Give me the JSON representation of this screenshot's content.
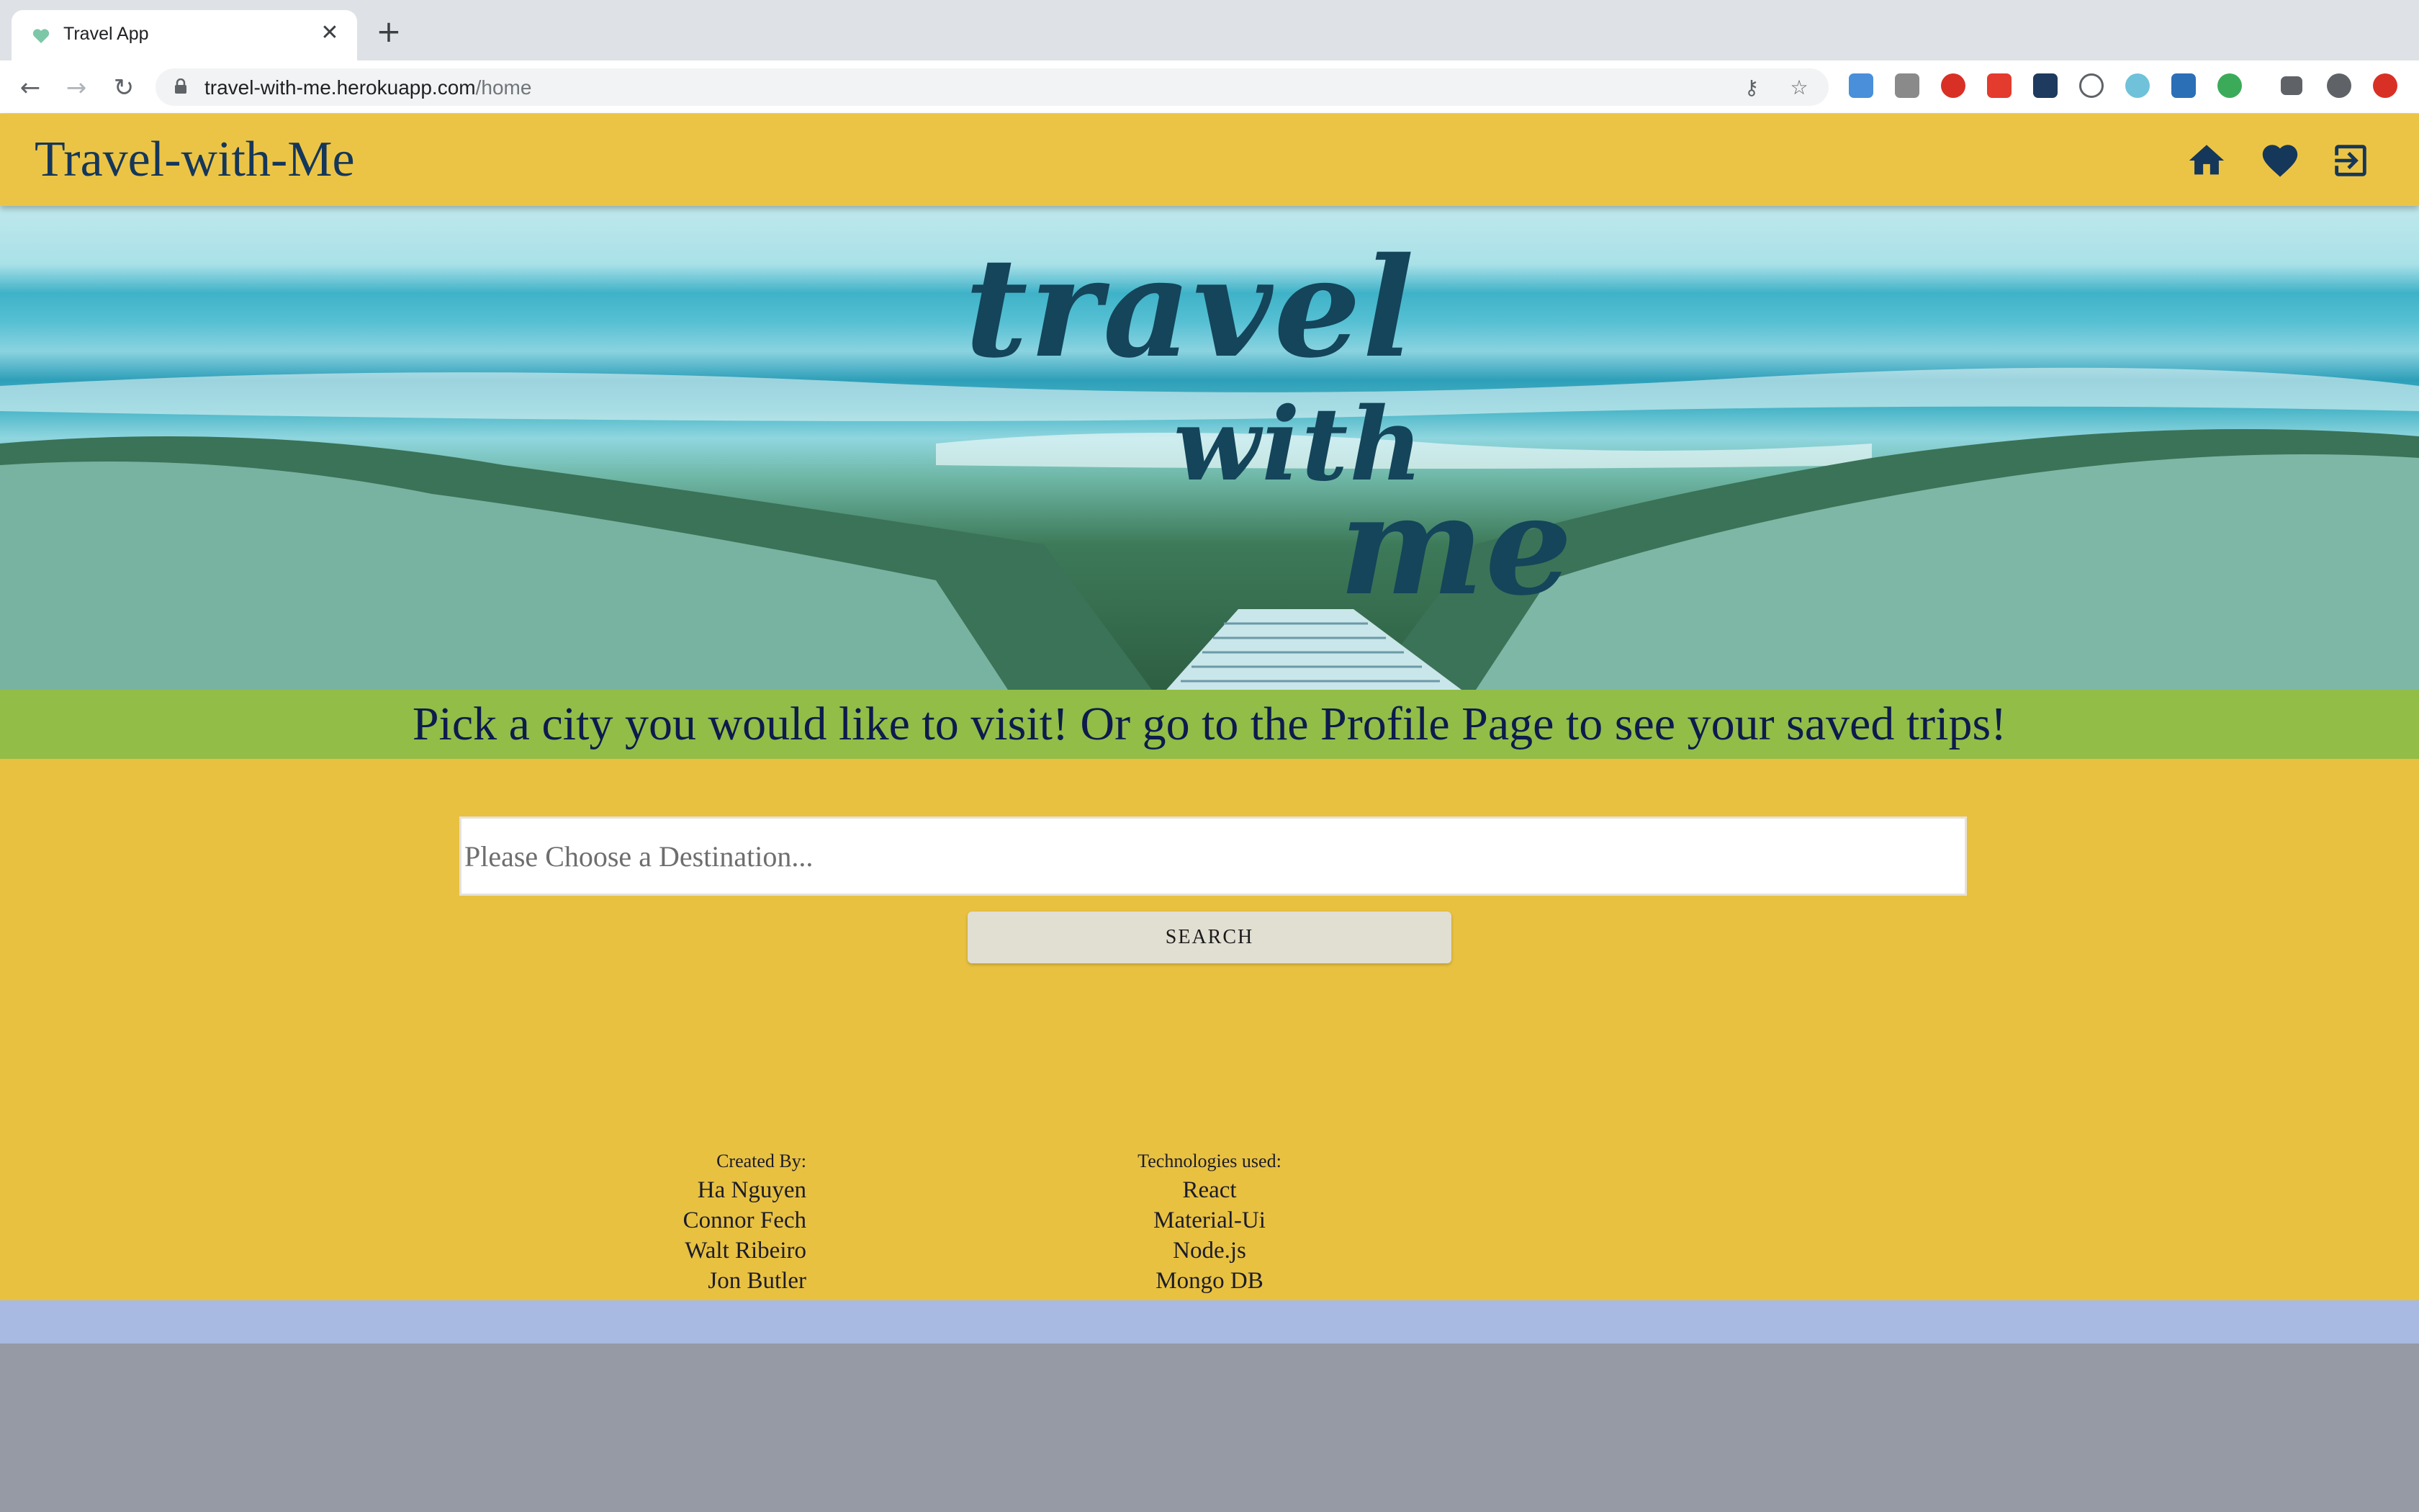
{
  "browser": {
    "tab_title": "Travel App",
    "close_glyph": "✕",
    "new_tab_glyph": "+",
    "back_glyph": "←",
    "forward_glyph": "→",
    "reload_glyph": "↻",
    "url_host": "travel-with-me.herokuapp.com",
    "url_path": "/home",
    "key_glyph": "⚷",
    "star_glyph": "☆",
    "menu_glyph": "⋮"
  },
  "app": {
    "brand": "Travel-with-Me",
    "nav_icons": [
      "home-icon",
      "heart-icon",
      "logout-icon"
    ],
    "accent_color": "#ecc445",
    "text_color": "#15375a"
  },
  "hero": {
    "word1": "travel",
    "word2": "with",
    "word3": "me"
  },
  "banner": {
    "text": "Pick a city you would like to visit! Or go to the Profile Page to see your saved trips!",
    "color": "#92bd47"
  },
  "search": {
    "placeholder": "Please Choose a Destination...",
    "value": "",
    "button_label": "SEARCH"
  },
  "footer": {
    "creators_heading": "Created By:",
    "creators": [
      "Ha Nguyen",
      "Connor Fech",
      "Walt Ribeiro",
      "Jon Butler"
    ],
    "tech_heading": "Technologies used:",
    "technologies": [
      "React",
      "Material-Ui",
      "Node.js",
      "Mongo DB"
    ]
  }
}
